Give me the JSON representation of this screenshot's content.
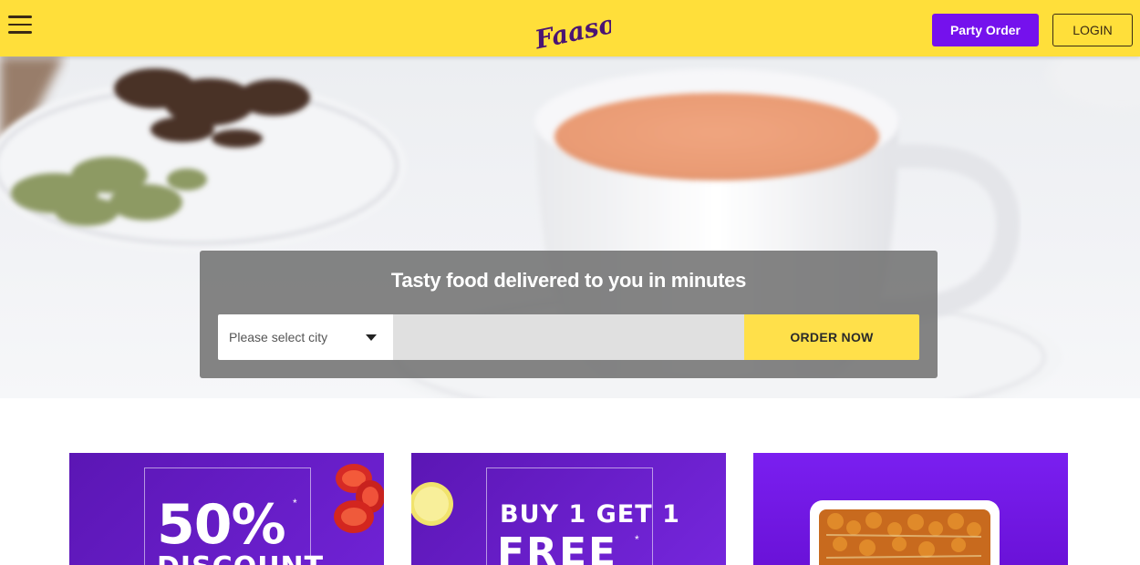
{
  "header": {
    "brand": "Faasos",
    "party_order_label": "Party Order",
    "login_label": "LOGIN",
    "icons": {
      "menu": "hamburger-menu-icon"
    }
  },
  "hero": {
    "tagline": "Tasty food delivered to you in minutes",
    "city_select": {
      "placeholder": "Please select city"
    },
    "locality_input": {
      "value": "",
      "placeholder": ""
    },
    "order_button_label": "ORDER NOW"
  },
  "offers": [
    {
      "line1": "50%",
      "line2": "DISCOUNT"
    },
    {
      "line1": "BUY 1 GET 1",
      "line2": "FREE"
    },
    {
      "line1": "",
      "line2": ""
    }
  ],
  "colors": {
    "header_yellow": "#ffdf3a",
    "brand_purple": "#7511ed",
    "order_yellow": "#ffe04a"
  }
}
